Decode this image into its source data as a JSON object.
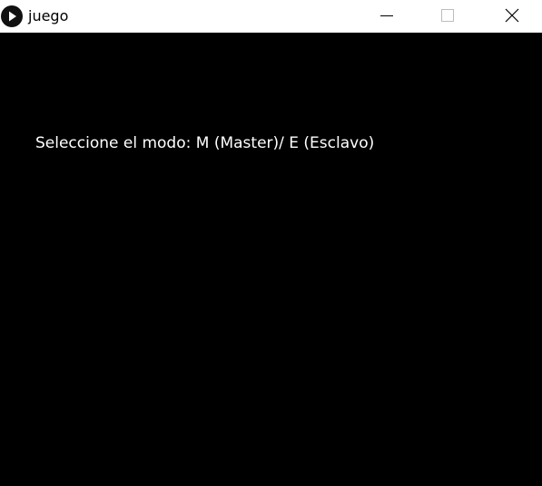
{
  "window": {
    "title": "juego",
    "icon": "play-icon",
    "controls": {
      "minimize_icon": "minimize-icon",
      "maximize_icon": "maximize-icon",
      "close_icon": "close-icon"
    }
  },
  "canvas": {
    "prompt": "Seleccione el modo: M (Master)/ E (Esclavo)",
    "background": "#000000",
    "text_color": "#ffffff"
  },
  "colors": {
    "titlebar": "#ffffff",
    "title_text": "#000000",
    "icon_fill": "#111111",
    "icon_symbol": "#ffffff"
  }
}
